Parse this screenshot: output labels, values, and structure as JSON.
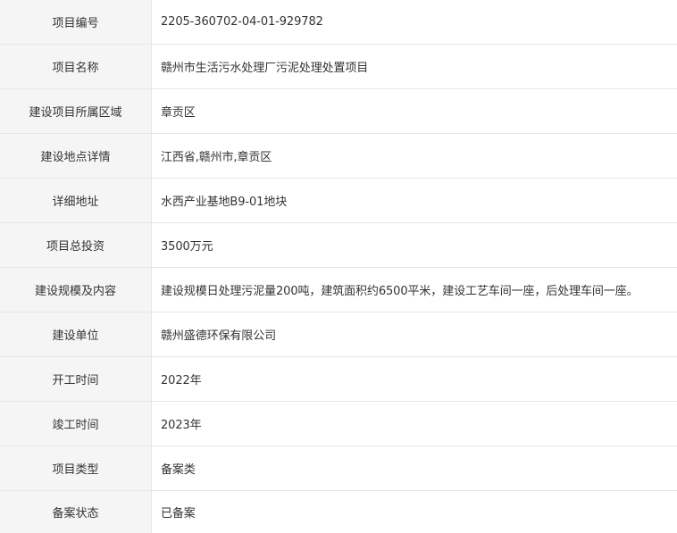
{
  "rows": [
    {
      "label": "项目编号",
      "value": "2205-360702-04-01-929782"
    },
    {
      "label": "项目名称",
      "value": "赣州市生活污水处理厂污泥处理处置项目"
    },
    {
      "label": "建设项目所属区域",
      "value": "章贡区"
    },
    {
      "label": "建设地点详情",
      "value": "江西省,赣州市,章贡区"
    },
    {
      "label": "详细地址",
      "value": "水西产业基地B9-01地块"
    },
    {
      "label": "项目总投资",
      "value": "3500万元"
    },
    {
      "label": "建设规模及内容",
      "value": "建设规模日处理污泥量200吨，建筑面积约6500平米，建设工艺车间一座，后处理车间一座。"
    },
    {
      "label": "建设单位",
      "value": "赣州盛德环保有限公司"
    },
    {
      "label": "开工时间",
      "value": "2022年"
    },
    {
      "label": "竣工时间",
      "value": "2023年"
    },
    {
      "label": "项目类型",
      "value": "备案类"
    },
    {
      "label": "备案状态",
      "value": "已备案"
    }
  ]
}
